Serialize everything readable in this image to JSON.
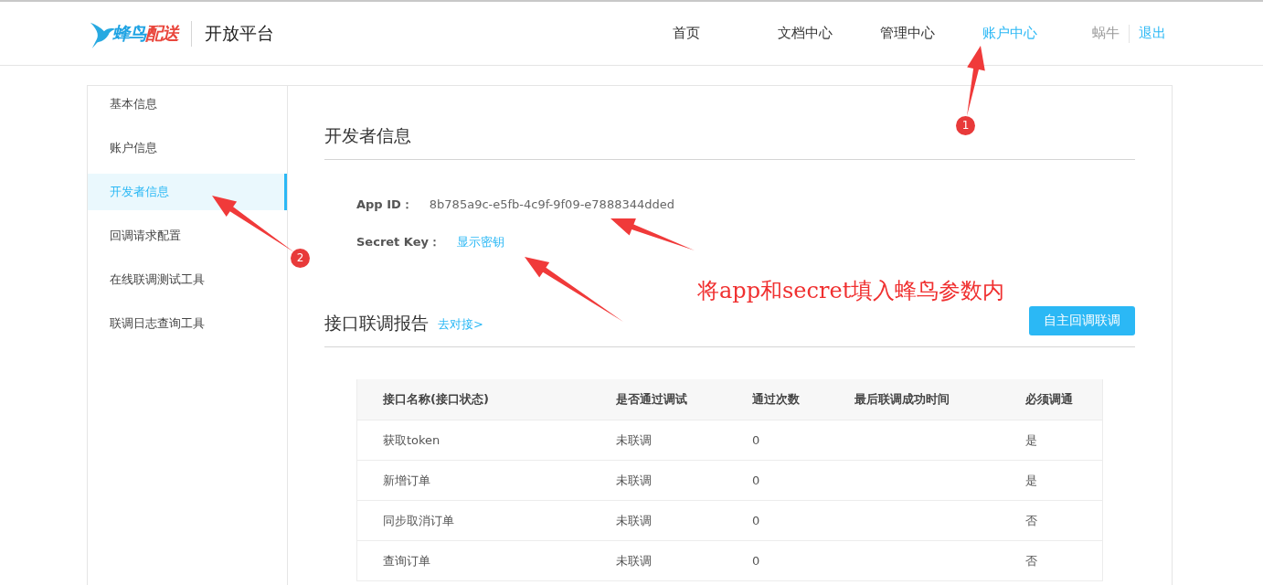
{
  "header": {
    "logo": {
      "part_1": "蜂鸟",
      "part_2": "配送"
    },
    "platform": "开放平台",
    "nav": [
      {
        "label": "首页",
        "selected": false
      },
      {
        "label": "文档中心",
        "selected": false
      },
      {
        "label": "管理中心",
        "selected": false
      },
      {
        "label": "账户中心",
        "selected": true
      }
    ],
    "user": "蜗牛",
    "logout": "退出"
  },
  "sidebar": {
    "items": [
      {
        "label": "基本信息",
        "selected": false
      },
      {
        "label": "账户信息",
        "selected": false
      },
      {
        "label": "开发者信息",
        "selected": true
      },
      {
        "label": "回调请求配置",
        "selected": false
      },
      {
        "label": "在线联调测试工具",
        "selected": false
      },
      {
        "label": "联调日志查询工具",
        "selected": false
      }
    ]
  },
  "developer": {
    "title": "开发者信息",
    "fields": [
      {
        "kind": "text",
        "label": "App ID：",
        "value": "8b785a9c-e5fb-4c9f-9f09-e7888344dded"
      },
      {
        "kind": "link",
        "label": "Secret Key：",
        "value": "显示密钥"
      }
    ]
  },
  "report": {
    "title": "接口联调报告",
    "link": "去对接>",
    "button": "自主回调联调",
    "table": {
      "columns": [
        "接口名称(接口状态)",
        "是否通过调试",
        "通过次数",
        "最后联调成功时间",
        "必须调通"
      ],
      "rows": [
        [
          "获取token",
          "未联调",
          "0",
          "",
          "是"
        ],
        [
          "新增订单",
          "未联调",
          "0",
          "",
          "是"
        ],
        [
          "同步取消订单",
          "未联调",
          "0",
          "",
          "否"
        ],
        [
          "查询订单",
          "未联调",
          "0",
          "",
          "否"
        ]
      ]
    }
  },
  "annotations": {
    "badges": [
      "1",
      "2"
    ],
    "note": "将app和secret填入蜂鸟参数内"
  }
}
